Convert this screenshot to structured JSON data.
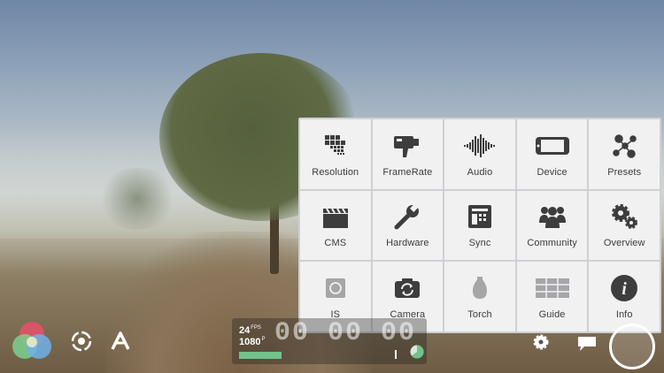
{
  "app": {
    "screen": "camera-viewfinder-settings-menu"
  },
  "settings_menu": {
    "items": [
      {
        "label": "Resolution",
        "icon": "resolution-grid-icon"
      },
      {
        "label": "FrameRate",
        "icon": "movie-camera-icon"
      },
      {
        "label": "Audio",
        "icon": "audio-waveform-icon"
      },
      {
        "label": "Device",
        "icon": "phone-device-icon"
      },
      {
        "label": "Presets",
        "icon": "presets-molecule-icon"
      },
      {
        "label": "CMS",
        "icon": "clapperboard-icon"
      },
      {
        "label": "Hardware",
        "icon": "wrench-icon"
      },
      {
        "label": "Sync",
        "icon": "sync-icon"
      },
      {
        "label": "Community",
        "icon": "community-people-icon"
      },
      {
        "label": "Overview",
        "icon": "gears-icon"
      },
      {
        "label": "IS",
        "icon": "image-stabilization-icon"
      },
      {
        "label": "Camera",
        "icon": "camera-switch-icon"
      },
      {
        "label": "Torch",
        "icon": "torch-bulb-icon"
      },
      {
        "label": "Guide",
        "icon": "guide-grid-icon"
      },
      {
        "label": "Info",
        "icon": "info-icon"
      }
    ]
  },
  "hud": {
    "fps_value": "24",
    "fps_unit": "FPS",
    "resolution_value": "1080",
    "resolution_unit": "P",
    "timecode": "00 00 00",
    "storage_fill": 0.4,
    "battery_fill": 0.65
  },
  "colors": {
    "panel_bg": "#f1f1f2",
    "grid_line": "#cfd0d3",
    "icon": "#3d3d3d",
    "storage": "#72c28c",
    "battery": "#6fc38f"
  }
}
